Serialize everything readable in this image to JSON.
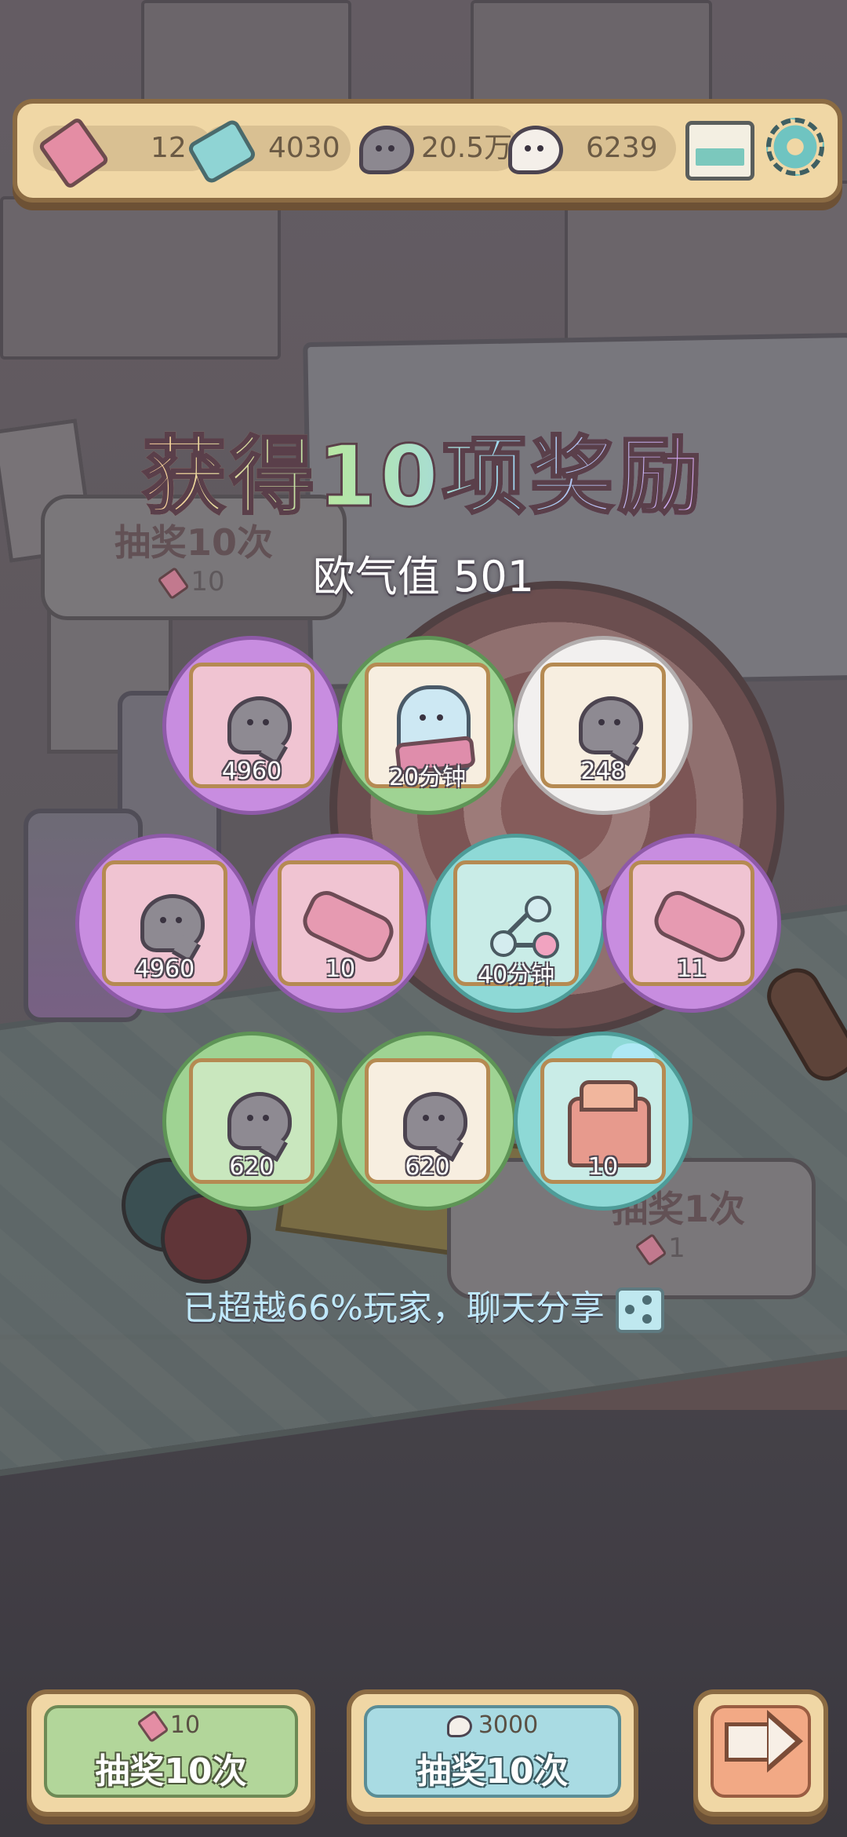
{
  "currencies": {
    "tickets": "12",
    "gems": "4030",
    "dark_ghosts": "20.5万",
    "light_ghosts": "6239"
  },
  "background_panels": {
    "draw10_title": "抽奖10次",
    "draw10_cost": "10",
    "draw1_title": "抽奖1次",
    "draw1_cost": "1"
  },
  "title": "获得10项奖励",
  "luck": "欧气值 501",
  "rewards": [
    {
      "qty": "4960",
      "icon": "ghost-currency-icon",
      "rarity": "purple"
    },
    {
      "qty": "20分钟",
      "icon": "sheet-ghost-icon",
      "rarity": "green"
    },
    {
      "qty": "248",
      "icon": "ghost-currency-icon",
      "rarity": "white"
    },
    {
      "qty": "4960",
      "icon": "ghost-currency-icon",
      "rarity": "purple"
    },
    {
      "qty": "10",
      "icon": "cannon-icon",
      "rarity": "purple"
    },
    {
      "qty": "40分钟",
      "icon": "molecule-icon",
      "rarity": "cyan"
    },
    {
      "qty": "11",
      "icon": "cannon-icon",
      "rarity": "purple"
    },
    {
      "qty": "620",
      "icon": "ghost-currency-icon",
      "rarity": "green"
    },
    {
      "qty": "620",
      "icon": "ghost-currency-icon",
      "rarity": "green"
    },
    {
      "qty": "10",
      "icon": "throne-icon",
      "rarity": "cyan"
    }
  ],
  "share_text": "已超越66%玩家，聊天分享",
  "buttons": {
    "ticket_draw": {
      "cost": "10",
      "label": "抽奖10次"
    },
    "ghost_draw": {
      "cost": "3000",
      "label": "抽奖10次"
    }
  },
  "colors": {
    "purple": "#c88de0",
    "green": "#9fd393",
    "white": "#f2f0ef",
    "cyan": "#8ed9d6"
  }
}
